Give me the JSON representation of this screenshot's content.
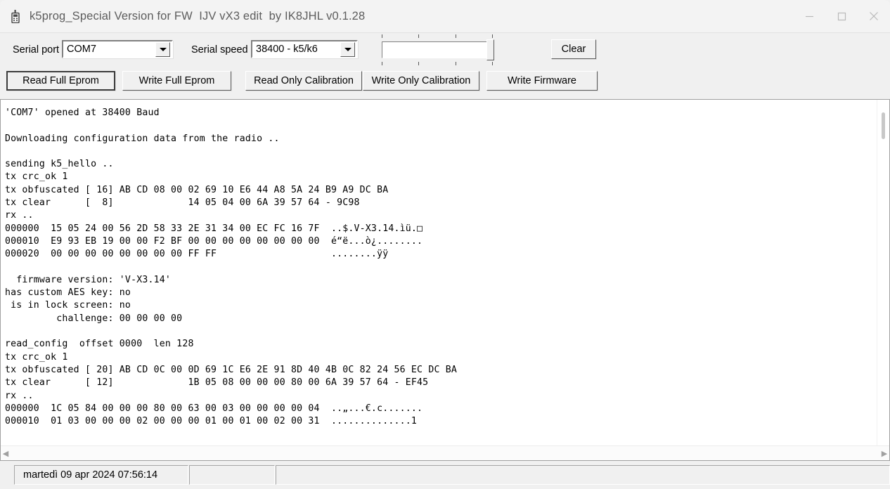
{
  "window": {
    "title": "k5prog_Special Version for FW  IJV vX3 edit  by IK8JHL v0.1.28",
    "icon": "radio-icon",
    "controls": {
      "minimize": "minimize-icon",
      "maximize": "maximize-icon",
      "close": "close-icon"
    }
  },
  "toolbar": {
    "serial_port_label": "Serial port",
    "serial_port_value": "COM7",
    "serial_speed_label": "Serial speed",
    "serial_speed_value": "38400 - k5/k6",
    "clear_label": "Clear",
    "progress_value": "",
    "buttons": [
      {
        "label": "Read Full Eprom",
        "default": true
      },
      {
        "label": "Write Full Eprom",
        "default": false
      },
      {
        "label": "Read Only Calibration",
        "default": false
      },
      {
        "label": "Write Only Calibration",
        "default": false
      },
      {
        "label": "Write Firmware",
        "default": false
      }
    ]
  },
  "log": {
    "content": "'COM7' opened at 38400 Baud\n\nDownloading configuration data from the radio ..\n\nsending k5_hello ..\ntx crc_ok 1\ntx obfuscated [ 16] AB CD 08 00 02 69 10 E6 44 A8 5A 24 B9 A9 DC BA\ntx clear      [  8]             14 05 04 00 6A 39 57 64 - 9C98\nrx ..\n000000  15 05 24 00 56 2D 58 33 2E 31 34 00 EC FC 16 7F  ..$.V-X3.14.ìü.□\n000010  E9 93 EB 19 00 00 F2 BF 00 00 00 00 00 00 00 00  é“ë...ò¿........\n000020  00 00 00 00 00 00 00 00 FF FF                    ........ÿÿ\n\n  firmware version: 'V-X3.14'\nhas custom AES key: no\n is in lock screen: no\n         challenge: 00 00 00 00\n\nread_config  offset 0000  len 128\ntx crc_ok 1\ntx obfuscated [ 20] AB CD 0C 00 0D 69 1C E6 2E 91 8D 40 4B 0C 82 24 56 EC DC BA\ntx clear      [ 12]             1B 05 08 00 00 00 80 00 6A 39 57 64 - EF45\nrx ..\n000000  1C 05 84 00 00 00 80 00 63 00 03 00 00 00 00 04  ..„...€.c.......\n000010  01 03 00 00 00 02 00 00 00 01 00 01 00 02 00 31  ..............1"
  },
  "statusbar": {
    "datetime": "martedì 09 apr 2024  07:56:14",
    "panel2": "",
    "panel3": ""
  },
  "colors": {
    "window_bg": "#f0f0f0",
    "titlebar_bg": "#f3f3f3",
    "title_text": "#5d5d5d",
    "log_bg": "#ffffff",
    "log_text": "#000000",
    "border": "#a0a0a0"
  }
}
